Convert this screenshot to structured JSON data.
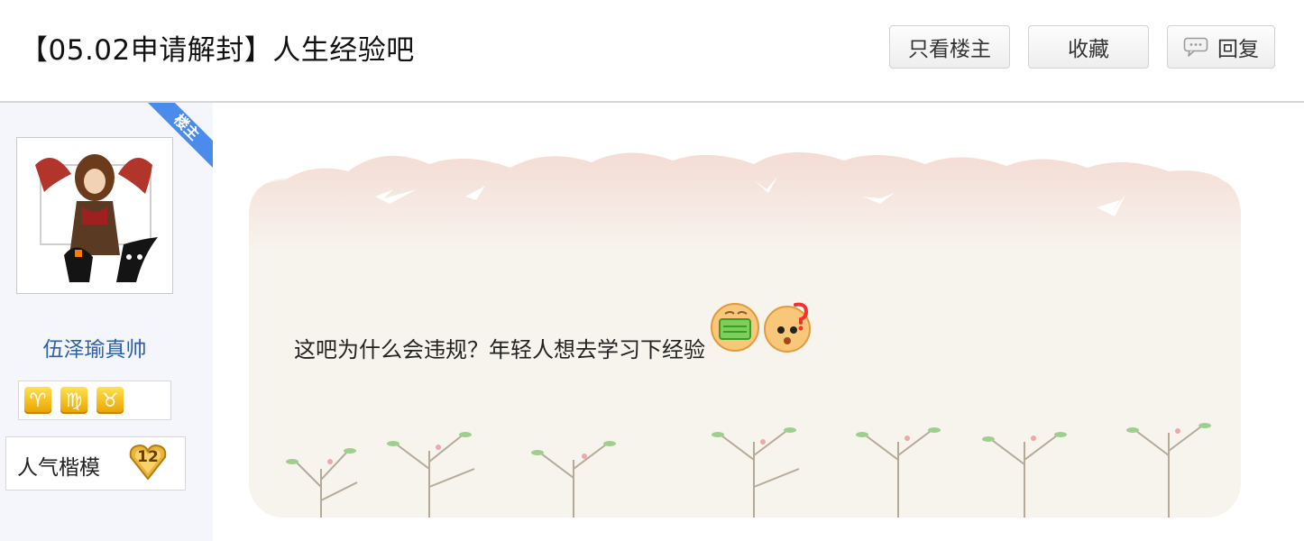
{
  "header": {
    "title": "【05.02申请解封】人生经验吧",
    "buttons": {
      "only_op": "只看楼主",
      "favorite": "收藏",
      "reply": "回复"
    }
  },
  "author": {
    "corner_tag": "楼主",
    "username": "伍泽瑜真帅",
    "zodiac_icons": [
      "♈",
      "♍",
      "♉"
    ],
    "badge": {
      "label": "人气楷模",
      "level": "12"
    }
  },
  "post": {
    "text": "这吧为什么会违规？年轻人想去学习下经验",
    "emojis": [
      "money-face-icon",
      "confused-face-icon"
    ]
  },
  "colors": {
    "username": "#2f5fa8",
    "corner": "#4a8bec",
    "card": "#f7f4ee",
    "clouds": "#f3e1da",
    "side": "#f4f6fb"
  }
}
